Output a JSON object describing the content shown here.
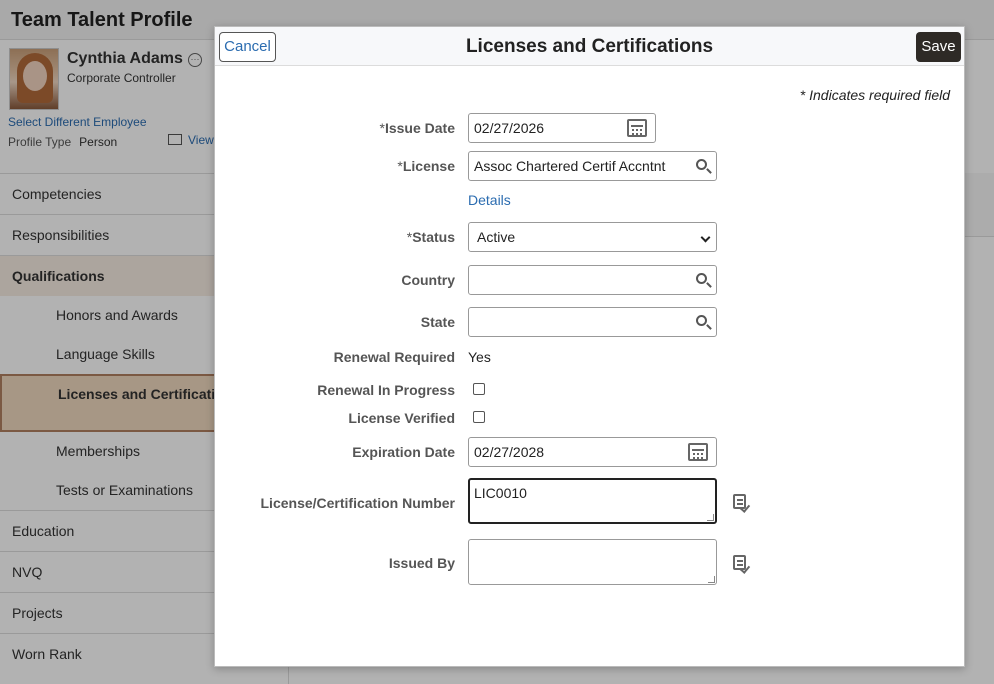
{
  "page": {
    "title": "Team Talent Profile"
  },
  "employee": {
    "name": "Cynthia Adams",
    "role": "Corporate Controller",
    "select_link": "Select Different Employee",
    "profile_type_label": "Profile Type",
    "profile_type_value": "Person",
    "view_link": "View"
  },
  "nav": {
    "items": [
      {
        "label": "Competencies"
      },
      {
        "label": "Responsibilities"
      },
      {
        "label": "Qualifications"
      },
      {
        "label": "Honors and Awards"
      },
      {
        "label": "Language Skills"
      },
      {
        "label": "Licenses and Certifications"
      },
      {
        "label": "Memberships"
      },
      {
        "label": "Tests or Examinations"
      },
      {
        "label": "Education"
      },
      {
        "label": "NVQ"
      },
      {
        "label": "Projects"
      },
      {
        "label": "Worn Rank"
      }
    ]
  },
  "modal": {
    "title": "Licenses and Certifications",
    "cancel_label": "Cancel",
    "save_label": "Save",
    "required_note": "* Indicates required field",
    "fields": {
      "issue_date": {
        "label": "Issue Date",
        "value": "02/27/2026"
      },
      "license": {
        "label": "License",
        "value": "Assoc Chartered Certif Accntnt",
        "details_link": "Details"
      },
      "status": {
        "label": "Status",
        "value": "Active"
      },
      "country": {
        "label": "Country",
        "value": ""
      },
      "state": {
        "label": "State",
        "value": ""
      },
      "renewal_required": {
        "label": "Renewal Required",
        "value": "Yes"
      },
      "renewal_in_progress": {
        "label": "Renewal In Progress",
        "checked": false
      },
      "license_verified": {
        "label": "License Verified",
        "checked": false
      },
      "expiration_date": {
        "label": "Expiration Date",
        "value": "02/27/2028"
      },
      "cert_number": {
        "label": "License/Certification Number",
        "value": "LIC0010"
      },
      "issued_by": {
        "label": "Issued By",
        "value": ""
      }
    },
    "required_marker": "*"
  },
  "colors": {
    "accent": "#2b6cb0",
    "save_bg": "#2e2a26",
    "selected_nav": "#f0d8bf"
  }
}
